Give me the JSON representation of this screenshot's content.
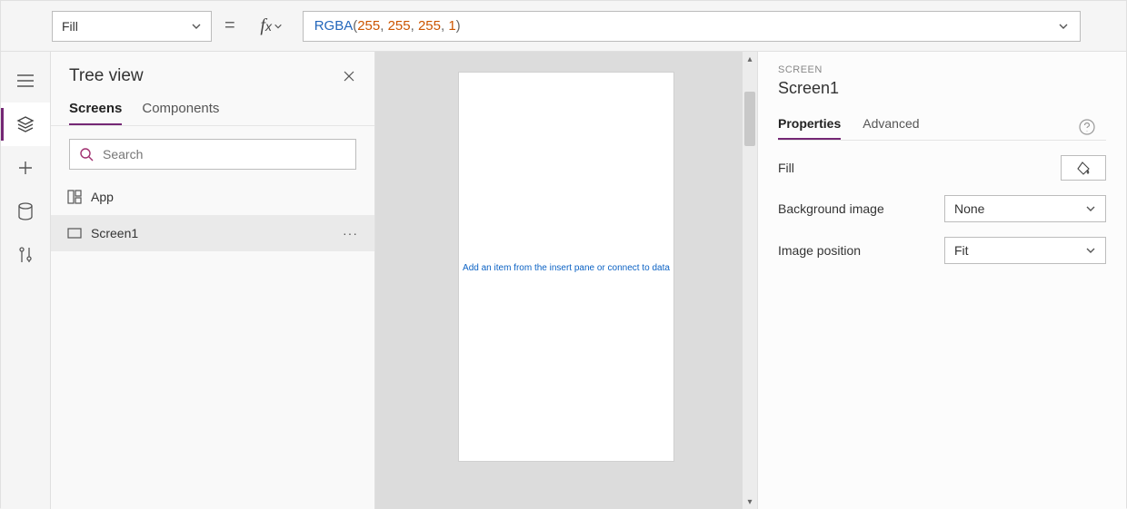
{
  "formula": {
    "property": "Fill",
    "equals": "=",
    "fx": "fx",
    "func": "RGBA",
    "args": [
      "255",
      "255",
      "255",
      "1"
    ]
  },
  "tree": {
    "title": "Tree view",
    "tabs": {
      "screens": "Screens",
      "components": "Components"
    },
    "searchPlaceholder": "Search",
    "items": [
      {
        "label": "App"
      },
      {
        "label": "Screen1"
      }
    ],
    "more": "···"
  },
  "canvas": {
    "hint": "Add an item from the insert pane or connect to data"
  },
  "props": {
    "category": "SCREEN",
    "selection": "Screen1",
    "tabs": {
      "properties": "Properties",
      "advanced": "Advanced"
    },
    "rows": {
      "fill": "Fill",
      "bgImage": "Background image",
      "bgImageValue": "None",
      "imgPos": "Image position",
      "imgPosValue": "Fit"
    }
  }
}
